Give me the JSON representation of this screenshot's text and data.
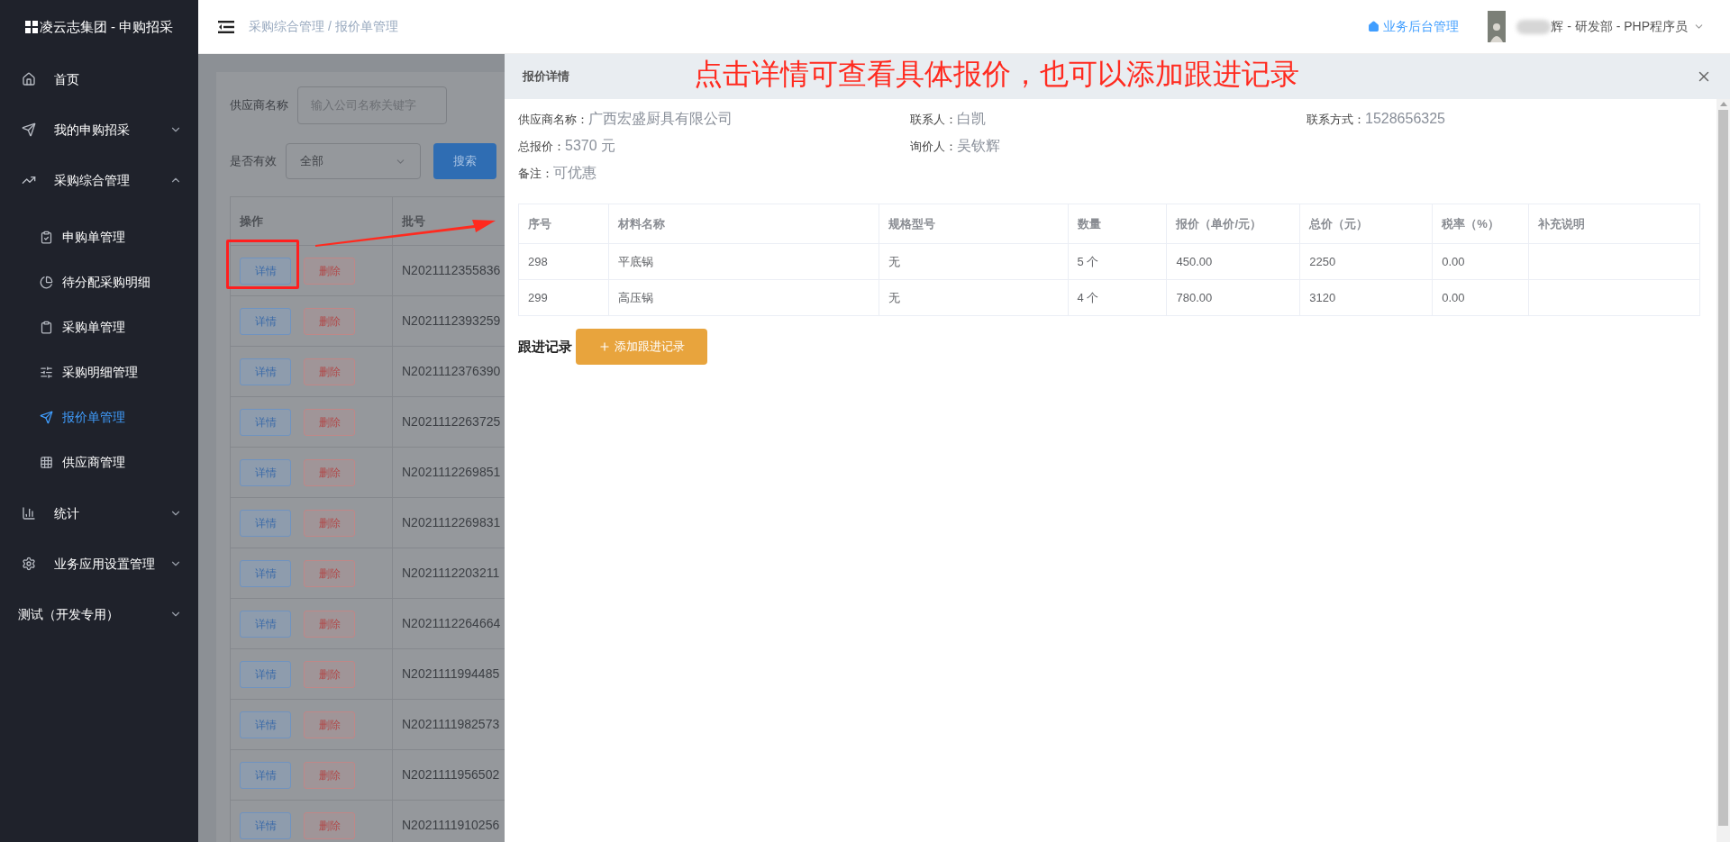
{
  "sidebar": {
    "logo_text": "凌云志集团 - 申购招采",
    "items": [
      {
        "label": "首页",
        "selected": false
      },
      {
        "label": "我的申购招采",
        "selected": false,
        "expanded": false
      },
      {
        "label": "采购综合管理",
        "selected": false,
        "expanded": true,
        "children": [
          {
            "label": "申购单管理",
            "selected": false
          },
          {
            "label": "待分配采购明细",
            "selected": false
          },
          {
            "label": "采购单管理",
            "selected": false
          },
          {
            "label": "采购明细管理",
            "selected": false
          },
          {
            "label": "报价单管理",
            "selected": true
          },
          {
            "label": "供应商管理",
            "selected": false
          }
        ]
      },
      {
        "label": "统计",
        "selected": false,
        "expanded": false
      },
      {
        "label": "业务应用设置管理",
        "selected": false,
        "expanded": false
      },
      {
        "label": "测试（开发专用）",
        "selected": false,
        "expanded": false
      }
    ]
  },
  "header": {
    "breadcrumb": "采购综合管理 / 报价单管理",
    "home_link": "业务后台管理",
    "user": "辉 - 研发部 - PHP程序员"
  },
  "filters": {
    "supplier_label": "供应商名称",
    "supplier_placeholder": "输入公司名称关键字",
    "valid_label": "是否有效",
    "valid_value": "全部",
    "search_button": "搜索"
  },
  "list": {
    "columns": [
      "操作",
      "批号"
    ],
    "rows": [
      {
        "detail_button": "详情",
        "delete_button": "删除",
        "batch": "N2021112355836"
      },
      {
        "detail_button": "详情",
        "delete_button": "删除",
        "batch": "N2021112393259"
      },
      {
        "detail_button": "详情",
        "delete_button": "删除",
        "batch": "N2021112376390"
      },
      {
        "detail_button": "详情",
        "delete_button": "删除",
        "batch": "N2021112263725"
      },
      {
        "detail_button": "详情",
        "delete_button": "删除",
        "batch": "N2021112269851"
      },
      {
        "detail_button": "详情",
        "delete_button": "删除",
        "batch": "N2021112269831"
      },
      {
        "detail_button": "详情",
        "delete_button": "删除",
        "batch": "N2021112203211"
      },
      {
        "detail_button": "详情",
        "delete_button": "删除",
        "batch": "N2021112264664"
      },
      {
        "detail_button": "详情",
        "delete_button": "删除",
        "batch": "N2021111994485"
      },
      {
        "detail_button": "详情",
        "delete_button": "删除",
        "batch": "N2021111982573"
      },
      {
        "detail_button": "详情",
        "delete_button": "删除",
        "batch": "N2021111956502"
      },
      {
        "detail_button": "详情",
        "delete_button": "删除",
        "batch": "N2021111910256"
      }
    ]
  },
  "annotation": {
    "text": "点击详情可查看具体报价，也可以添加跟进记录"
  },
  "drawer": {
    "title": "报价详情",
    "info": [
      [
        {
          "label": "供应商名称：",
          "value": "广西宏盛厨具有限公司"
        },
        {
          "label": "联系人：",
          "value": "白凯"
        },
        {
          "label": "联系方式：",
          "value": "1528656325"
        }
      ],
      [
        {
          "label": "总报价：",
          "value": "5370 元"
        },
        {
          "label": "询价人：",
          "value": "吴钦辉"
        }
      ],
      [
        {
          "label": "备注：",
          "value": "可优惠"
        }
      ]
    ],
    "table": {
      "columns": [
        "序号",
        "材料名称",
        "规格型号",
        "数量",
        "报价（单价/元）",
        "总价（元）",
        "税率（%）",
        "补充说明"
      ],
      "rows": [
        [
          "298",
          "平底锅",
          "无",
          "5 个",
          "450.00",
          "2250",
          "0.00",
          ""
        ],
        [
          "299",
          "高压锅",
          "无",
          "4 个",
          "780.00",
          "3120",
          "0.00",
          ""
        ]
      ]
    },
    "follow_label": "跟进记录",
    "add_button": "添加跟进记录"
  }
}
